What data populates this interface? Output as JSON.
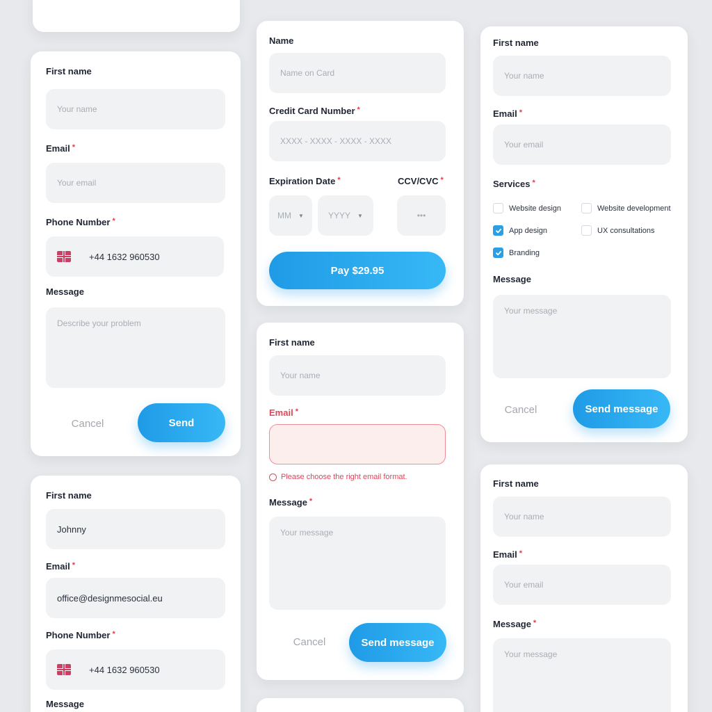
{
  "card1": {
    "first_name_label": "First name",
    "first_name_placeholder": "Your name",
    "email_label": "Email",
    "email_placeholder": "Your email",
    "phone_label": "Phone Number",
    "phone_value": "+44 1632 960530",
    "message_label": "Message",
    "message_placeholder": "Describe your problem",
    "cancel_label": "Cancel",
    "send_label": "Send"
  },
  "card2": {
    "first_name_label": "First name",
    "first_name_value": "Johnny",
    "email_label": "Email",
    "email_value": "office@designmesocial.eu",
    "phone_label": "Phone Number",
    "phone_value": "+44 1632 960530",
    "message_label": "Message"
  },
  "payment": {
    "name_label": "Name",
    "name_placeholder": "Name on Card",
    "card_number_label": "Credit Card Number",
    "card_number_placeholder": "XXXX - XXXX - XXXX - XXXX",
    "expiration_label": "Expiration Date",
    "month_placeholder": "MM",
    "year_placeholder": "YYYY",
    "cvc_label": "CCV/CVC",
    "cvc_placeholder": "•••",
    "pay_label": "Pay $29.95"
  },
  "error_form": {
    "first_name_label": "First name",
    "first_name_placeholder": "Your name",
    "email_label": "Email",
    "email_error": "Please choose the right email format.",
    "message_label": "Message",
    "message_placeholder": "Your message",
    "cancel_label": "Cancel",
    "send_label": "Send message"
  },
  "services_form": {
    "first_name_label": "First name",
    "first_name_placeholder": "Your name",
    "email_label": "Email",
    "email_placeholder": "Your email",
    "services_label": "Services",
    "services": [
      {
        "label": "Website design",
        "checked": false
      },
      {
        "label": "Website development",
        "checked": false
      },
      {
        "label": "App design",
        "checked": true
      },
      {
        "label": "UX consultations",
        "checked": false
      },
      {
        "label": "Branding",
        "checked": true
      }
    ],
    "message_label": "Message",
    "message_placeholder": "Your message",
    "cancel_label": "Cancel",
    "send_label": "Send message"
  },
  "card6": {
    "first_name_label": "First name",
    "first_name_placeholder": "Your name",
    "email_label": "Email",
    "email_placeholder": "Your email",
    "message_label": "Message",
    "message_placeholder": "Your message"
  },
  "required_mark": "*",
  "colors": {
    "accent": "#219de8",
    "error": "#e0455a",
    "field_bg": "#f1f2f4",
    "page_bg": "#e7e9ec"
  }
}
